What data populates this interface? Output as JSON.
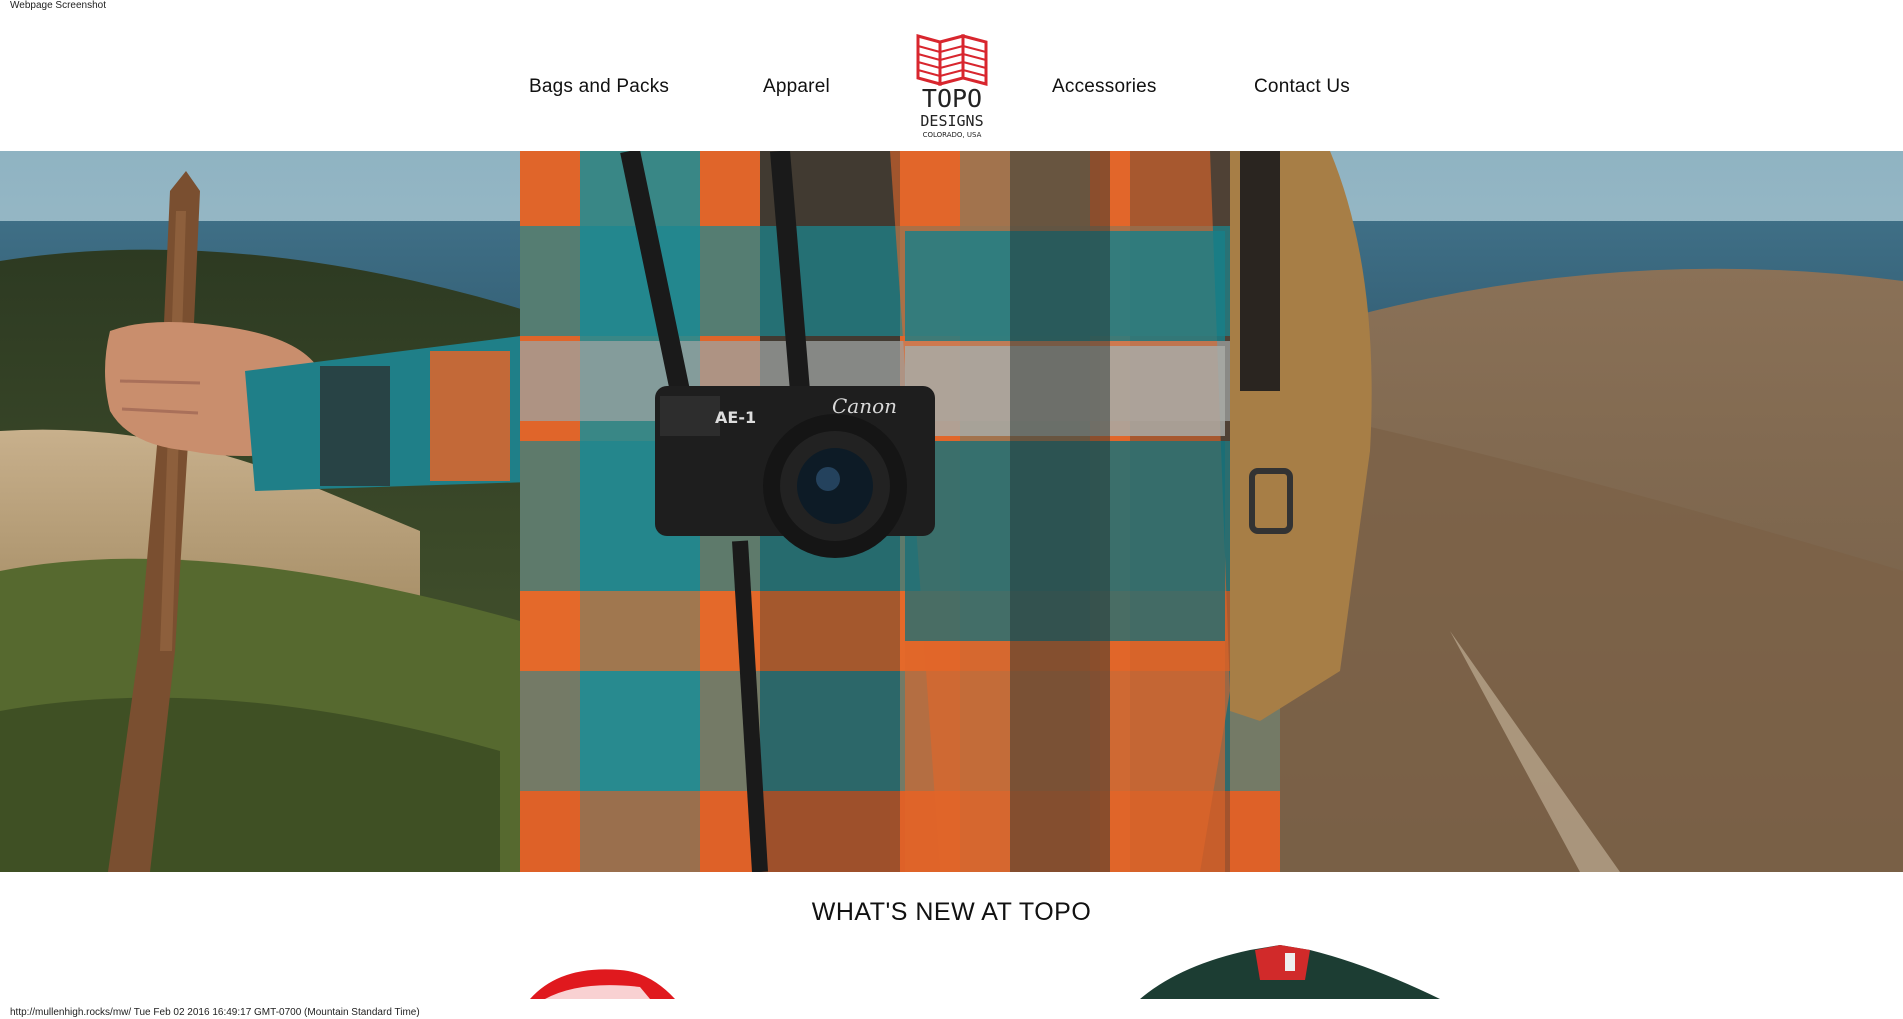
{
  "screenshot_label": "Webpage Screenshot",
  "nav": {
    "items": [
      {
        "label": "Bags and Packs"
      },
      {
        "label": "Apparel"
      },
      {
        "label": "Accessories"
      },
      {
        "label": "Contact Us"
      }
    ]
  },
  "logo": {
    "line1": "TOPO",
    "line2": "DESIGNS",
    "line3": "COLORADO, USA",
    "color": "#d8262e"
  },
  "hero": {
    "camera_brand": "Canon",
    "camera_badge": "AE-1"
  },
  "section": {
    "title": "WHAT'S NEW AT TOPO"
  },
  "status_bar": {
    "text": "http://mullenhigh.rocks/mw/ Tue Feb 02 2016 16:49:17 GMT-0700 (Mountain Standard Time)"
  }
}
